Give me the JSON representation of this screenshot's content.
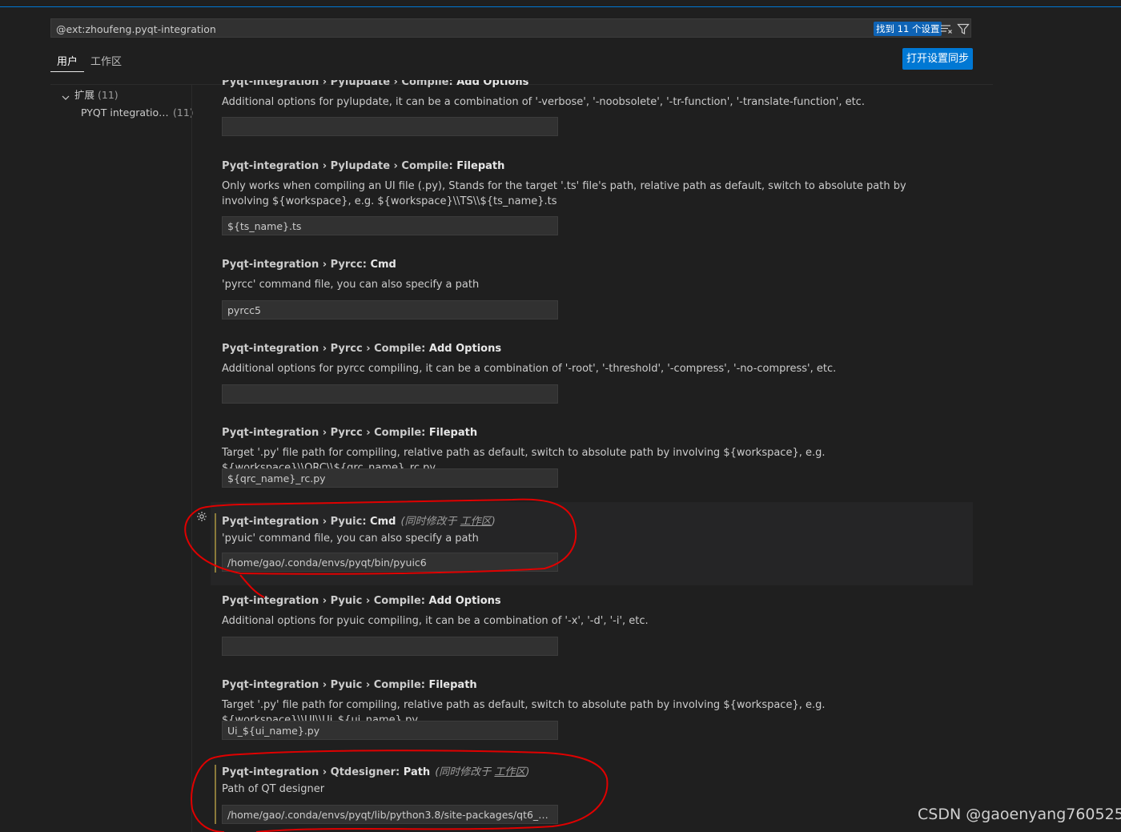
{
  "search": {
    "value": "@ext:zhoufeng.pyqt-integration",
    "result_count": "找到 11 个设置"
  },
  "icons": {
    "clear": "clear-filter-icon",
    "filter": "filter-icon",
    "gear": "gear-icon",
    "chevron": "chevron-down-icon"
  },
  "tabs": {
    "user": "用户",
    "workspace": "工作区"
  },
  "sync_button": "打开设置同步",
  "toc": {
    "group": {
      "label": "扩展",
      "count": "(11)"
    },
    "item": {
      "label": "PYQT integratio…",
      "count": "(11)"
    }
  },
  "settings": [
    {
      "category": "Pyqt-integration › Pylupdate › Compile: ",
      "key": "Add Options",
      "description": "Additional options for pylupdate, it can be a combination of '-verbose', '-noobsolete', '-tr-function', '-translate-function', etc.",
      "value": ""
    },
    {
      "category": "Pyqt-integration › Pylupdate › Compile: ",
      "key": "Filepath",
      "description": "Only works when compiling an UI file (.py), Stands for the target '.ts' file's path, relative path as default, switch to absolute path by involving ${workspace}, e.g. ${workspace}\\\\TS\\\\${ts_name}.ts",
      "value": "${ts_name}.ts"
    },
    {
      "category": "Pyqt-integration › Pyrcc: ",
      "key": "Cmd",
      "description": "'pyrcc' command file, you can also specify a path",
      "value": "pyrcc5"
    },
    {
      "category": "Pyqt-integration › Pyrcc › Compile: ",
      "key": "Add Options",
      "description": "Additional options for pyrcc compiling, it can be a combination of '-root', '-threshold', '-compress', '-no-compress', etc.",
      "value": ""
    },
    {
      "category": "Pyqt-integration › Pyrcc › Compile: ",
      "key": "Filepath",
      "description": "Target '.py' file path for compiling, relative path as default, switch to absolute path by involving ${workspace}, e.g. ${workspace}\\\\QRC\\\\${qrc_name}_rc.py",
      "value": "${qrc_name}_rc.py"
    },
    {
      "category": "Pyqt-integration › Pyuic: ",
      "key": "Cmd",
      "modified_prefix": "(同时修改于 ",
      "modified_link": "工作区",
      "modified_suffix": ")",
      "description": "'pyuic' command file, you can also specify a path",
      "value": "/home/gao/.conda/envs/pyqt/bin/pyuic6"
    },
    {
      "category": "Pyqt-integration › Pyuic › Compile: ",
      "key": "Add Options",
      "description": "Additional options for pyuic compiling, it can be a combination of '-x', '-d', '-i', etc.",
      "value": ""
    },
    {
      "category": "Pyqt-integration › Pyuic › Compile: ",
      "key": "Filepath",
      "description": "Target '.py' file path for compiling, relative path as default, switch to absolute path by involving ${workspace}, e.g. ${workspace}\\\\UI\\\\Ui_${ui_name}.py",
      "value": "Ui_${ui_name}.py"
    },
    {
      "category": "Pyqt-integration › Qtdesigner: ",
      "key": "Path",
      "modified_prefix": "(同时修改于 ",
      "modified_link": "工作区",
      "modified_suffix": ")",
      "description": "Path of QT designer",
      "value": "/home/gao/.conda/envs/pyqt/lib/python3.8/site-packages/qt6_ap…"
    }
  ],
  "watermark": "CSDN @gaoenyang760525",
  "colors": {
    "accent": "#0078d4",
    "background": "#1f1f1f",
    "annotation": "#e00000"
  }
}
